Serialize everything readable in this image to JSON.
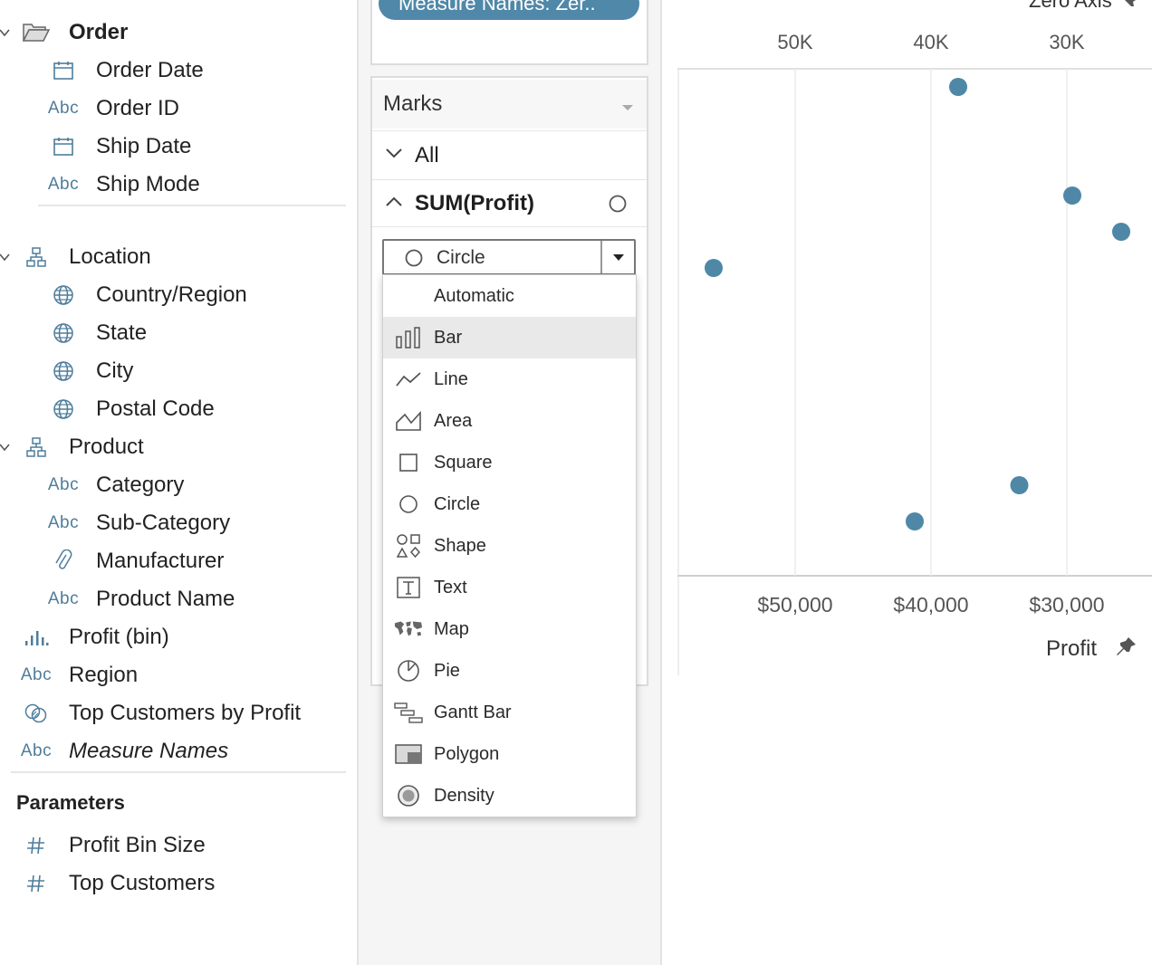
{
  "data_pane": {
    "order_folder": "Order",
    "order_fields": [
      "Order Date",
      "Order ID",
      "Ship Date",
      "Ship Mode"
    ],
    "location_folder": "Location",
    "location_fields": [
      "Country/Region",
      "State",
      "City",
      "Postal Code"
    ],
    "product_folder": "Product",
    "product_fields": [
      "Category",
      "Sub-Category",
      "Manufacturer",
      "Product Name"
    ],
    "other_fields": [
      "Profit (bin)",
      "Region",
      "Top Customers by Profit",
      "Measure Names"
    ],
    "abc_label": "Abc",
    "parameters_header": "Parameters",
    "parameters": [
      "Profit Bin Size",
      "Top Customers"
    ]
  },
  "shelves": {
    "measure_pill": "Measure Names: Zer.."
  },
  "marks": {
    "title": "Marks",
    "all_label": "All",
    "measure_label": "SUM(Profit)",
    "selected_type": "Circle",
    "options": [
      "Automatic",
      "Bar",
      "Line",
      "Area",
      "Square",
      "Circle",
      "Shape",
      "Text",
      "Map",
      "Pie",
      "Gantt Bar",
      "Polygon",
      "Density"
    ],
    "highlighted_option": "Bar"
  },
  "view": {
    "top_axis_title": "Zero Axis",
    "top_ticks": [
      "50K",
      "40K",
      "30K"
    ],
    "bottom_ticks": [
      "$50,000",
      "$40,000",
      "$30,000"
    ],
    "bottom_axis_title": "Profit",
    "mark_color": "#4e88a6"
  },
  "chart_data": {
    "type": "scatter",
    "xlabel": "Profit",
    "x_reversed": true,
    "x_ticks": [
      50000,
      40000,
      30000
    ],
    "grid": true,
    "points": [
      {
        "x": 38000
      },
      {
        "x": 29600
      },
      {
        "x": 56000
      },
      {
        "x": 26000
      },
      {
        "x": 33500
      },
      {
        "x": 41200
      }
    ]
  }
}
